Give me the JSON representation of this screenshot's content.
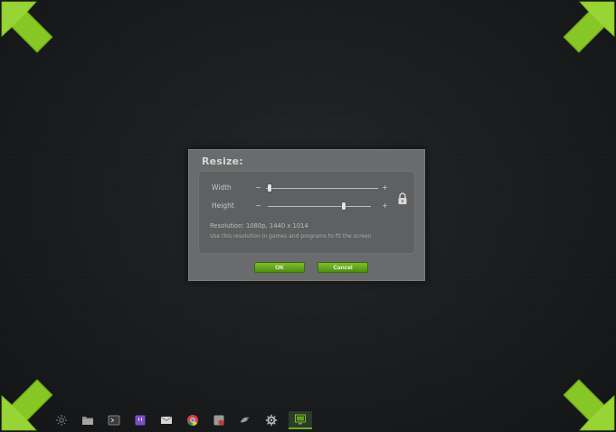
{
  "dialog": {
    "title": "Resize:",
    "width_label": "Width",
    "height_label": "Height",
    "width_value": 0.03,
    "height_value": 0.74,
    "decrement_symbol": "−",
    "increment_symbol": "+",
    "resolution_text": "Resolution: 1080p, 1440 x 1014",
    "hint_text": "Use this resolution in games and programs to fit the screen",
    "ok_label": "OK",
    "cancel_label": "Cancel"
  },
  "colors": {
    "accent_green": "#7ecb1e",
    "button_green": "#5fa218",
    "dialog_bg": "#6a6b6c"
  },
  "taskbar": {
    "icons": [
      "settings-cog-icon",
      "folder-icon",
      "terminal-icon",
      "twitch-icon",
      "mail-icon",
      "chrome-icon",
      "media-icon",
      "bird-icon",
      "gear-icon",
      "display-resize-icon"
    ]
  }
}
